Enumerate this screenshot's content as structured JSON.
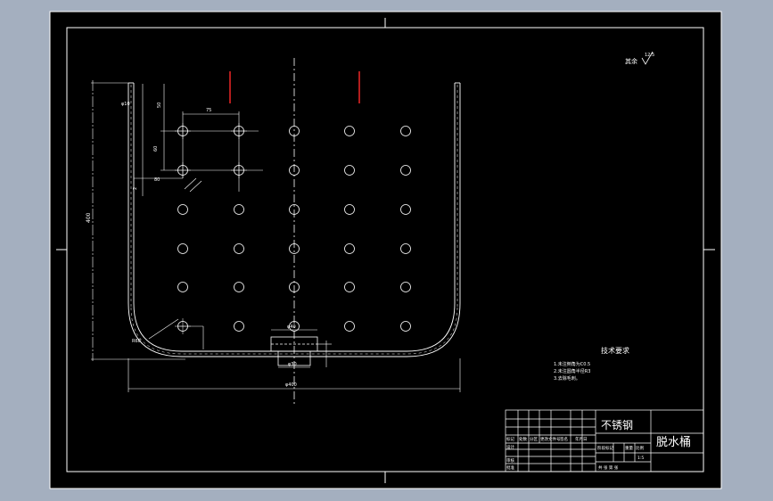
{
  "drawing": {
    "title": "脱水桶",
    "material": "不锈钢",
    "roughness_note": "其余",
    "roughness_value": "12.5",
    "scale": "1:5"
  },
  "tech_requirements": {
    "heading": "技术要求",
    "items": [
      "1.未注倒角为C0.5",
      "2.未注圆角半径R3",
      "3.去除毛刺。"
    ]
  },
  "dimensions": {
    "hole_pitch_h": "75",
    "hole_pitch_v": "60",
    "hole_offset_v": "50",
    "hole_offset_h": "80",
    "body_height": "400",
    "wall_thickness": "2",
    "corner_radius": "R60",
    "hole_dia": "φ10",
    "bottom_hole_top": "φ40",
    "bottom_hole_bottom": "φ30",
    "overall_width": "φ400"
  },
  "title_block": {
    "row_labels": [
      "标记",
      "处数",
      "分区",
      "更改文件号",
      "签名",
      "年月日"
    ],
    "designer_label": "设计",
    "stage_label": "阶段标记",
    "weight_label": "重量",
    "scale_label": "比例",
    "reviewer_label": "审核",
    "approve_label": "批准",
    "sheet_label": "共  张  第  张"
  },
  "colors": {
    "background": "#a4afbf",
    "sheet": "#000000",
    "line": "#ffffff",
    "center_line": "#ff2a2a"
  }
}
